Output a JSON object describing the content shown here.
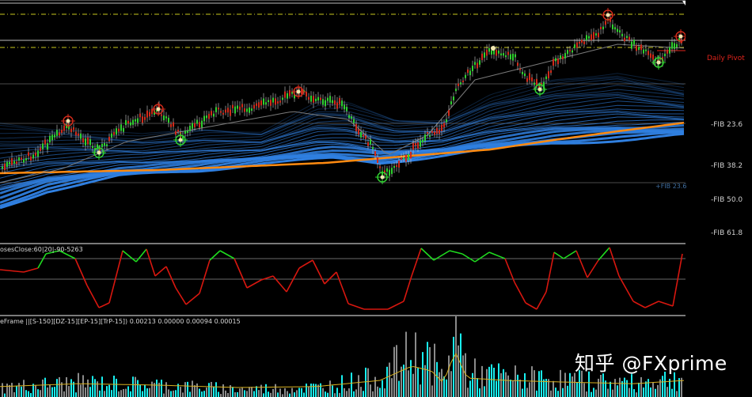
{
  "price_pane": {
    "pivot_label": "Daily Pivot",
    "fib_inner_label": "+FIB 23.6",
    "fib_labels": [
      "-FIB 23.6",
      "-FIB 38.2",
      "-FIB 50.0",
      "-FIB 61.8"
    ]
  },
  "osc_pane": {
    "label": "osesClose:60|20|-90-5263"
  },
  "vol_pane": {
    "label": "eFrame ||[S-150][DZ-15][EP-15][TrP-15]) 0.00213 0.00000 0.00094 0.00015"
  },
  "watermark": "知乎 @FXprime",
  "colors": {
    "background": "#000000",
    "bull_candle": "#2fd12f",
    "bear_candle": "#d12a1a",
    "ma_ribbon": "#2f7fe0",
    "orange_ma": "#ff8a10",
    "osc_up": "#1fdc1f",
    "osc_down": "#d8170f",
    "vol_cyan": "#18f0f0",
    "vol_grey": "#8a8a8a",
    "pivot": "#e0241c"
  }
}
